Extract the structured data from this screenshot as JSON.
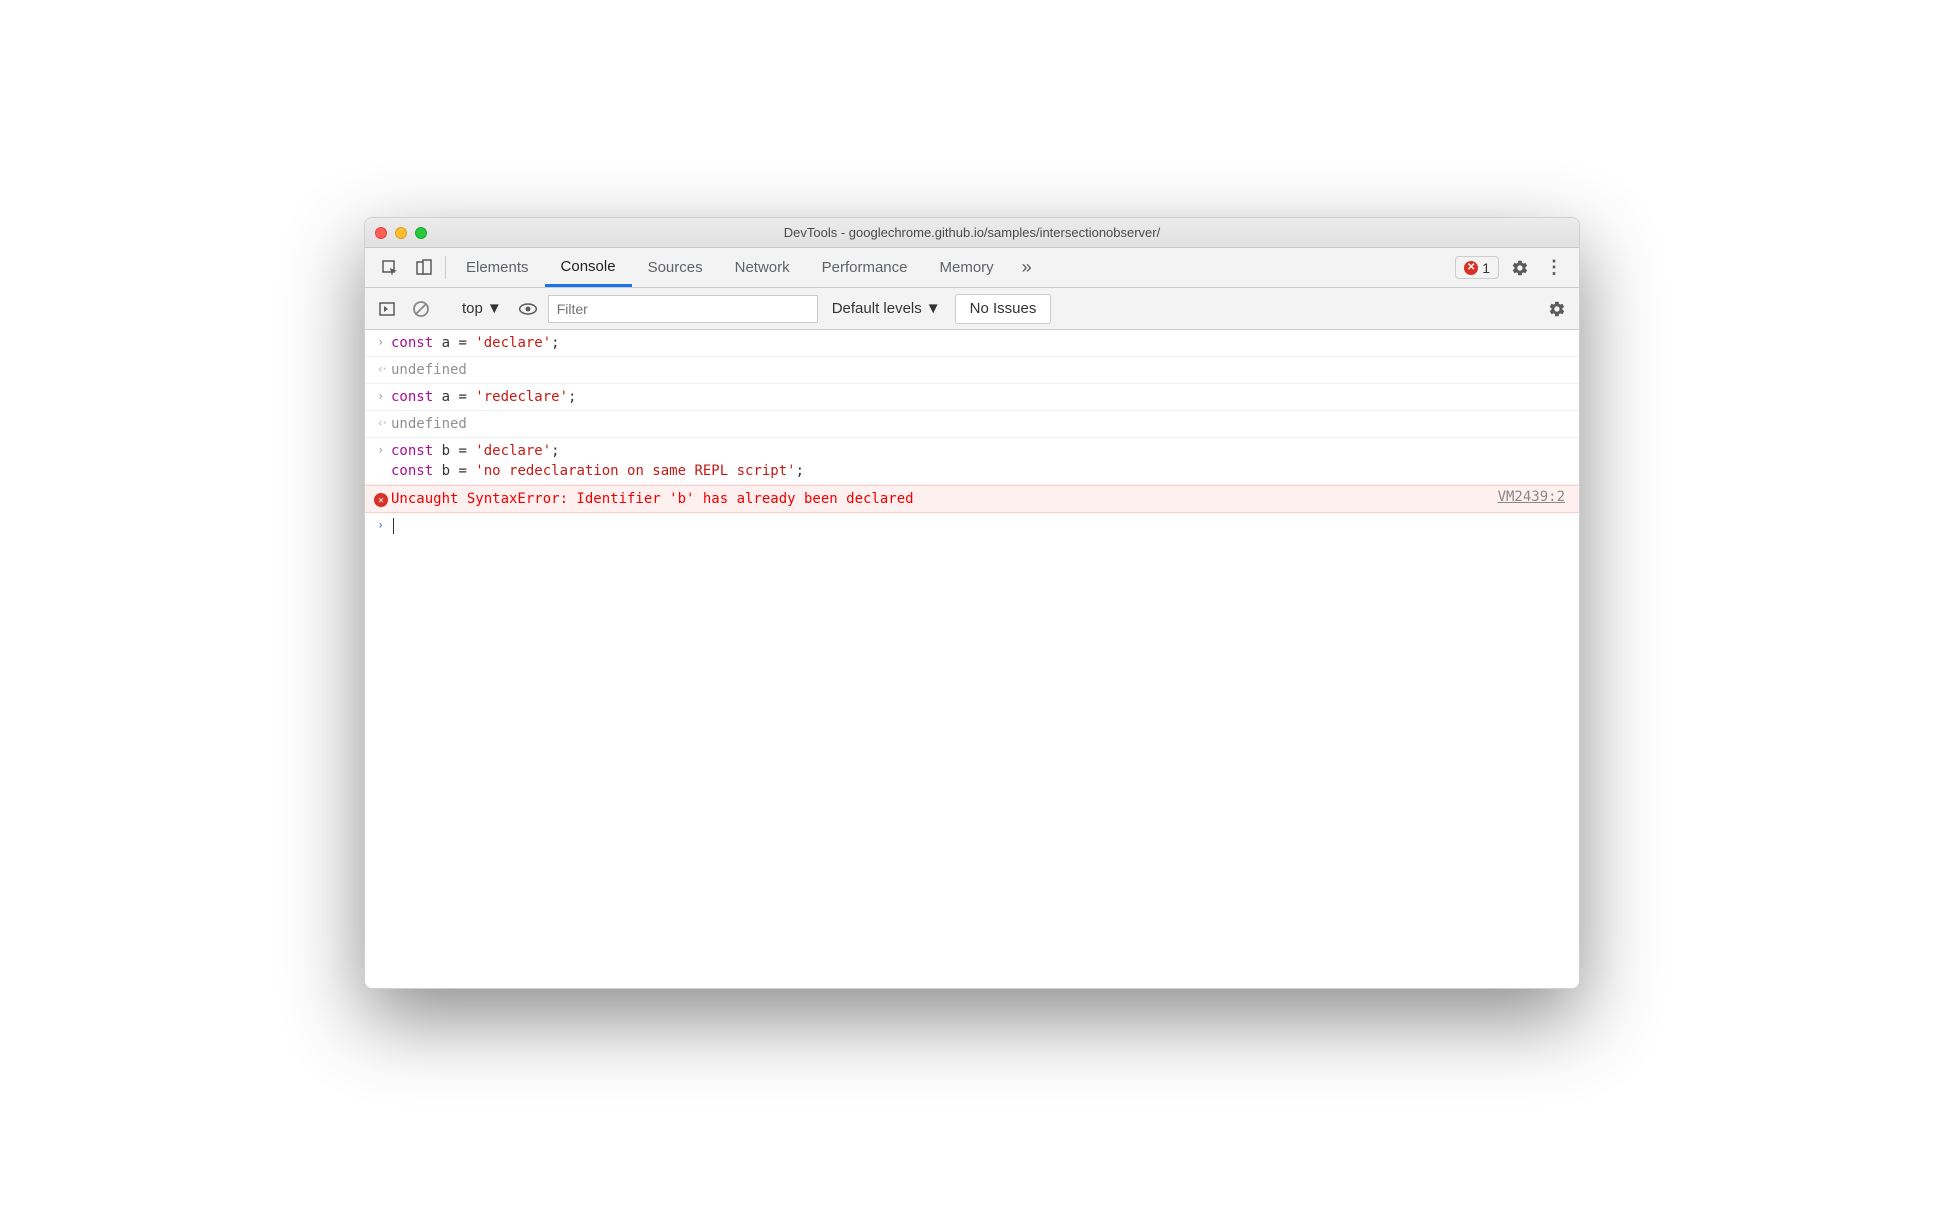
{
  "titlebar": {
    "title": "DevTools - googlechrome.github.io/samples/intersectionobserver/"
  },
  "tabbar": {
    "tabs": [
      {
        "label": "Elements"
      },
      {
        "label": "Console",
        "active": true
      },
      {
        "label": "Sources"
      },
      {
        "label": "Network"
      },
      {
        "label": "Performance"
      },
      {
        "label": "Memory"
      }
    ],
    "overflow_icon": "»",
    "error_count": "1"
  },
  "toolbar": {
    "context": "top",
    "filter_placeholder": "Filter",
    "levels": "Default levels",
    "issues_label": "No Issues"
  },
  "console_rows": [
    {
      "type": "input",
      "segments": [
        {
          "t": "const ",
          "c": "kw"
        },
        {
          "t": "a ",
          "c": "va"
        },
        {
          "t": "= ",
          "c": "eq"
        },
        {
          "t": "'declare'",
          "c": "st"
        },
        {
          "t": ";",
          "c": "pu"
        }
      ]
    },
    {
      "type": "output",
      "text": "undefined"
    },
    {
      "type": "input",
      "segments": [
        {
          "t": "const ",
          "c": "kw"
        },
        {
          "t": "a ",
          "c": "va"
        },
        {
          "t": "= ",
          "c": "eq"
        },
        {
          "t": "'redeclare'",
          "c": "st"
        },
        {
          "t": ";",
          "c": "pu"
        }
      ]
    },
    {
      "type": "output",
      "text": "undefined"
    },
    {
      "type": "input",
      "segments": [
        {
          "t": "const ",
          "c": "kw"
        },
        {
          "t": "b ",
          "c": "va"
        },
        {
          "t": "= ",
          "c": "eq"
        },
        {
          "t": "'declare'",
          "c": "st"
        },
        {
          "t": ";\n",
          "c": "pu"
        },
        {
          "t": "const ",
          "c": "kw"
        },
        {
          "t": "b ",
          "c": "va"
        },
        {
          "t": "= ",
          "c": "eq"
        },
        {
          "t": "'no redeclaration on same REPL script'",
          "c": "st"
        },
        {
          "t": ";",
          "c": "pu"
        }
      ]
    },
    {
      "type": "error",
      "text": "Uncaught SyntaxError: Identifier 'b' has already been declared",
      "source": "VM2439:2"
    },
    {
      "type": "prompt"
    }
  ]
}
